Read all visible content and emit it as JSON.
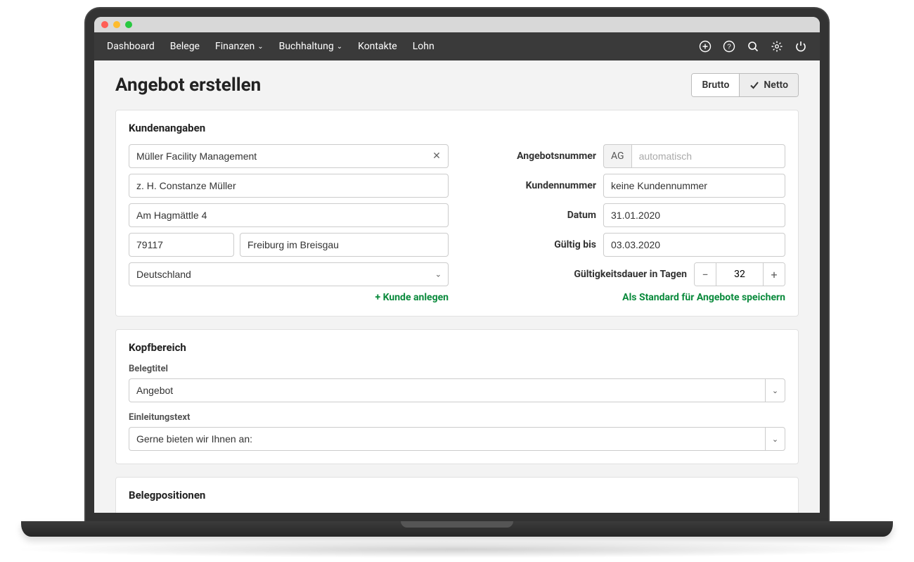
{
  "nav": {
    "items": [
      "Dashboard",
      "Belege",
      "Finanzen",
      "Buchhaltung",
      "Kontakte",
      "Lohn"
    ]
  },
  "page": {
    "title": "Angebot erstellen",
    "toggle": {
      "brutto": "Brutto",
      "netto": "Netto"
    }
  },
  "kunden": {
    "heading": "Kundenangaben",
    "name": "Müller Facility Management",
    "contact": "z. H. Constanze Müller",
    "street": "Am Hagmättle 4",
    "zip": "79117",
    "city": "Freiburg im Breisgau",
    "country": "Deutschland",
    "create_link": "+ Kunde anlegen"
  },
  "meta": {
    "angebotsnummer_label": "Angebotsnummer",
    "angebotsnummer_prefix": "AG",
    "angebotsnummer_placeholder": "automatisch",
    "kundennummer_label": "Kundennummer",
    "kundennummer_value": "keine Kundennummer",
    "datum_label": "Datum",
    "datum_value": "31.01.2020",
    "gueltig_label": "Gültig bis",
    "gueltig_value": "03.03.2020",
    "dauer_label": "Gültigkeitsdauer in Tagen",
    "dauer_value": "32",
    "save_link": "Als Standard für Angebote speichern"
  },
  "kopf": {
    "heading": "Kopfbereich",
    "belegtitel_label": "Belegtitel",
    "belegtitel_value": "Angebot",
    "einleitung_label": "Einleitungstext",
    "einleitung_value": "Gerne bieten wir Ihnen an:"
  },
  "positionen": {
    "heading": "Belegpositionen"
  }
}
